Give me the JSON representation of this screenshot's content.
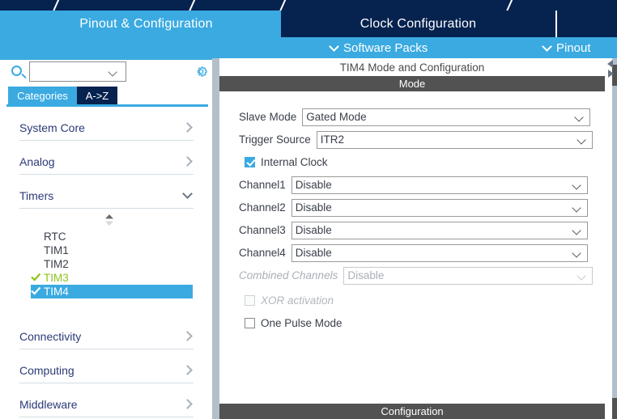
{
  "app": {
    "title_strip_color": "#06224f",
    "accent_blue": "#3aaae1",
    "navy": "#06224f",
    "green": "#8fc318",
    "section_gray": "#525252"
  },
  "tabs": [
    {
      "label": "Pinout & Configuration",
      "state": "active"
    },
    {
      "label": "Clock Configuration",
      "state": "inactive"
    },
    {
      "label": "",
      "state": "inactive"
    }
  ],
  "subbar": {
    "items": [
      {
        "label": "Software Packs",
        "icon": "chevron-down-icon"
      },
      {
        "label": "Pinout",
        "icon": "chevron-down-icon"
      }
    ]
  },
  "sidebar": {
    "search": {
      "value": "",
      "placeholder": "",
      "icon": "search-icon"
    },
    "settings_icon": "gear-icon",
    "view_tabs": [
      {
        "label": "Categories",
        "selected": true
      },
      {
        "label": "A->Z",
        "selected": false
      }
    ],
    "categories": [
      {
        "label": "System Core",
        "expanded": false
      },
      {
        "label": "Analog",
        "expanded": false
      },
      {
        "label": "Timers",
        "expanded": true
      },
      {
        "label": "Connectivity",
        "expanded": false
      },
      {
        "label": "Computing",
        "expanded": false
      },
      {
        "label": "Middleware",
        "expanded": false
      }
    ],
    "timer_items": [
      {
        "label": "RTC",
        "checked": false,
        "selected": false
      },
      {
        "label": "TIM1",
        "checked": false,
        "selected": false
      },
      {
        "label": "TIM2",
        "checked": false,
        "selected": false
      },
      {
        "label": "TIM3",
        "checked": true,
        "selected": false
      },
      {
        "label": "TIM4",
        "checked": true,
        "selected": true
      }
    ]
  },
  "panel": {
    "title": "TIM4 Mode and Configuration",
    "mode_header": "Mode",
    "configuration_header": "Configuration",
    "fields": [
      {
        "label": "Slave Mode",
        "value": "Gated Mode",
        "disabled": false
      },
      {
        "label": "Trigger Source",
        "value": "ITR2",
        "disabled": false
      },
      {
        "label": "Channel1",
        "value": "Disable",
        "disabled": false
      },
      {
        "label": "Channel2",
        "value": "Disable",
        "disabled": false
      },
      {
        "label": "Channel3",
        "value": "Disable",
        "disabled": false
      },
      {
        "label": "Channel4",
        "value": "Disable",
        "disabled": false
      },
      {
        "label": "Combined Channels",
        "value": "Disable",
        "disabled": true
      }
    ],
    "checkboxes": [
      {
        "label": "Internal Clock",
        "checked": true,
        "disabled": false
      },
      {
        "label": "XOR activation",
        "checked": false,
        "disabled": true
      },
      {
        "label": "One Pulse Mode",
        "checked": false,
        "disabled": false
      }
    ]
  }
}
